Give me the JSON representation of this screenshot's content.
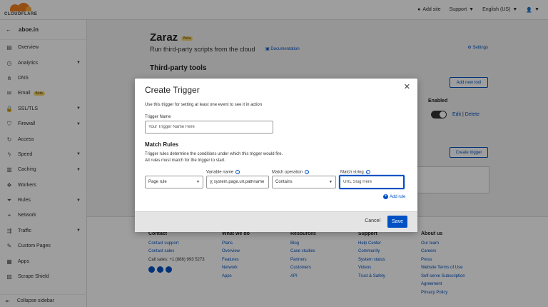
{
  "topbar": {
    "logo_text": "CLOUDFLARE",
    "add_site": "Add site",
    "support": "Support",
    "language": "English (US)"
  },
  "sidebar": {
    "domain": "aboe.in",
    "items": [
      {
        "label": "Overview",
        "icon": "file-icon",
        "chevron": false
      },
      {
        "label": "Analytics",
        "icon": "clock-icon",
        "chevron": true
      },
      {
        "label": "DNS",
        "icon": "network-icon",
        "chevron": false
      },
      {
        "label": "Email",
        "icon": "mail-icon",
        "chevron": false,
        "badge": "Beta"
      },
      {
        "label": "SSL/TLS",
        "icon": "lock-icon",
        "chevron": true
      },
      {
        "label": "Firewall",
        "icon": "shield-icon",
        "chevron": true
      },
      {
        "label": "Access",
        "icon": "access-icon",
        "chevron": false
      },
      {
        "label": "Speed",
        "icon": "lightning-icon",
        "chevron": true
      },
      {
        "label": "Caching",
        "icon": "server-icon",
        "chevron": true
      },
      {
        "label": "Workers",
        "icon": "workers-icon",
        "chevron": false
      },
      {
        "label": "Rules",
        "icon": "funnel-icon",
        "chevron": true
      },
      {
        "label": "Network",
        "icon": "pin-icon",
        "chevron": false
      },
      {
        "label": "Traffic",
        "icon": "traffic-icon",
        "chevron": true
      },
      {
        "label": "Custom Pages",
        "icon": "wrench-icon",
        "chevron": false
      },
      {
        "label": "Apps",
        "icon": "apps-icon",
        "chevron": false
      },
      {
        "label": "Scrape Shield",
        "icon": "doc-shield-icon",
        "chevron": false
      }
    ],
    "collapse": "Collapse sidebar"
  },
  "main": {
    "title": "Zaraz",
    "beta": "Beta",
    "subtitle": "Run third-party scripts from the cloud",
    "documentation": "Documentation",
    "settings": "Settings",
    "section_title": "Third-party tools",
    "add_new_tool": "Add new tool",
    "enabled": "Enabled",
    "edit": "Edit",
    "delete": "Delete",
    "create_trigger": "Create trigger"
  },
  "footer": {
    "columns": [
      {
        "heading": "Contact",
        "links": [
          "Contact support",
          "Contact sales"
        ],
        "plain": "Call sales: +1 (888) 993 5273"
      },
      {
        "heading": "What we do",
        "links": [
          "Plans",
          "Overview",
          "Features",
          "Network",
          "Apps"
        ]
      },
      {
        "heading": "Resources",
        "links": [
          "Blog",
          "Case studies",
          "Partners",
          "Customers",
          "API"
        ]
      },
      {
        "heading": "Support",
        "links": [
          "Help Center",
          "Community",
          "System status",
          "Videos",
          "Trust & Safety"
        ]
      },
      {
        "heading": "About us",
        "links": [
          "Our team",
          "Careers",
          "Press",
          "Website Terms of Use",
          "Self-serve Subscription Agreement",
          "Privacy Policy"
        ]
      }
    ]
  },
  "modal": {
    "title": "Create Trigger",
    "description": "Use this trigger for setting at least one event to see it in action",
    "trigger_name_label": "Trigger Name",
    "trigger_name_placeholder": "Your Trigger Name Here",
    "match_rules_heading": "Match Rules",
    "rules_line1": "Trigger rules determine the conditions under which this trigger would fire.",
    "rules_line2": "All rules must match for the trigger to start.",
    "rule_type": "Page rule",
    "variable_label": "Variable name",
    "variable_value": "{{ system.page.url.pathname }}",
    "operation_label": "Match operation",
    "operation_value": "Contains",
    "match_string_label": "Match string",
    "match_string_placeholder": "URL Slug Here",
    "add_rule": "Add rule",
    "cancel": "Cancel",
    "save": "Save"
  }
}
